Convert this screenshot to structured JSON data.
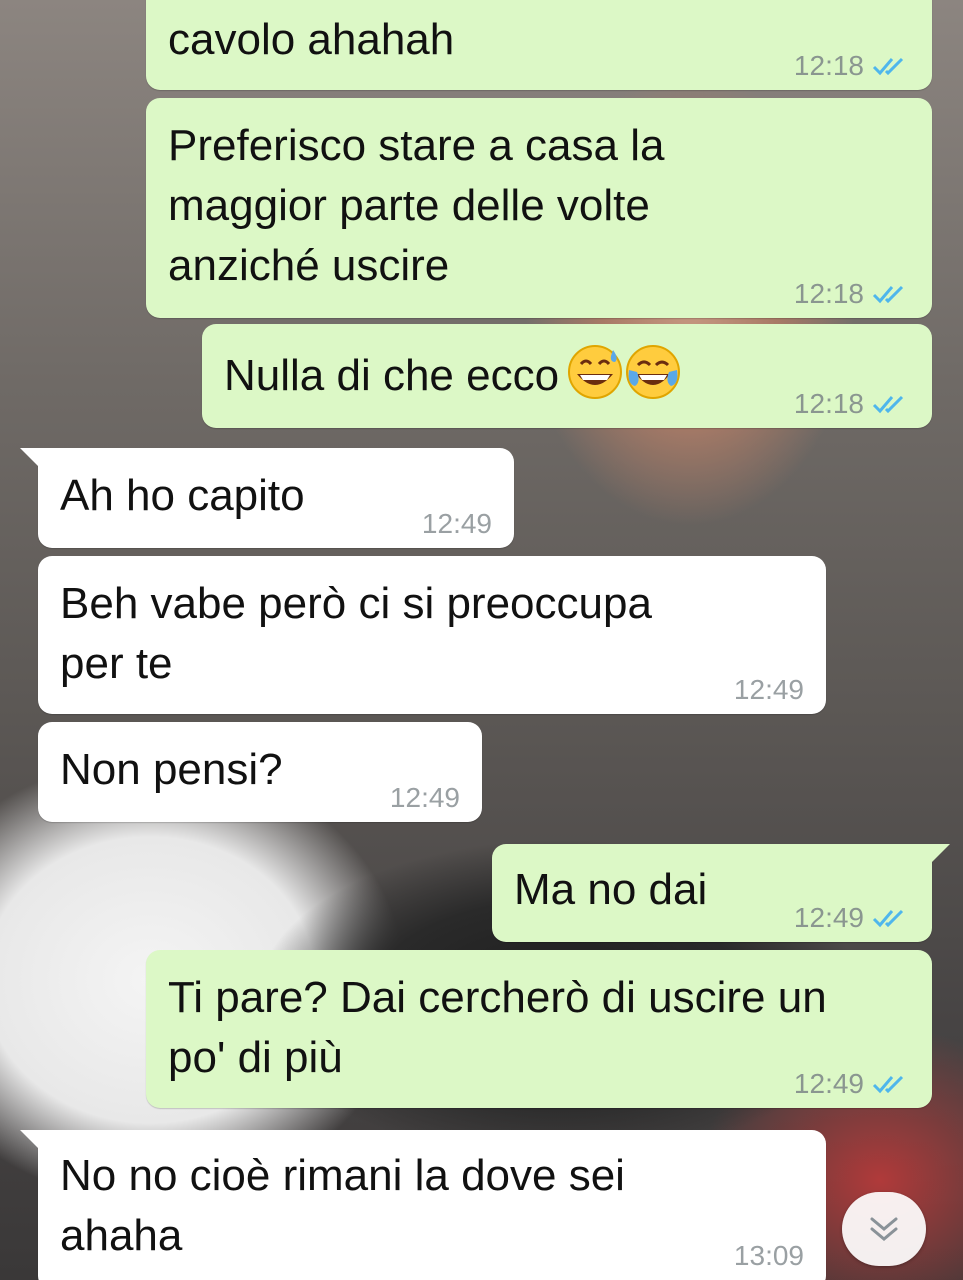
{
  "messages": [
    {
      "id": "m1",
      "direction": "outgoing",
      "text": "cavolo ahahah",
      "time": "12:18",
      "status": "read"
    },
    {
      "id": "m2",
      "direction": "outgoing",
      "text": "Preferisco stare a casa la\nmaggior parte delle volte\nanziché uscire",
      "time": "12:18",
      "status": "read"
    },
    {
      "id": "m3",
      "direction": "outgoing",
      "text": "Nulla di che ecco",
      "emojis": [
        "grinning-sweat-emoji",
        "tears-of-joy-emoji"
      ],
      "time": "12:18",
      "status": "read"
    },
    {
      "id": "m4",
      "direction": "incoming",
      "text": "Ah ho capito",
      "time": "12:49"
    },
    {
      "id": "m5",
      "direction": "incoming",
      "text": "Beh vabe però ci si preoccupa\nper te",
      "time": "12:49"
    },
    {
      "id": "m6",
      "direction": "incoming",
      "text": "Non pensi?",
      "time": "12:49"
    },
    {
      "id": "m7",
      "direction": "outgoing",
      "text": "Ma no dai",
      "time": "12:49",
      "status": "read"
    },
    {
      "id": "m8",
      "direction": "outgoing",
      "text": "Ti pare? Dai cercherò di uscire un\npo' di più",
      "time": "12:49",
      "status": "read"
    },
    {
      "id": "m9",
      "direction": "incoming",
      "text": "No no cioè rimani la dove sei\nahaha",
      "time": "13:09"
    }
  ],
  "colors": {
    "outgoing_bubble": "#dcf8c6",
    "incoming_bubble": "#ffffff",
    "read_ticks": "#4fb6ec"
  },
  "icons": {
    "read_status": "double-check-icon",
    "scroll_down": "double-chevron-down-icon"
  }
}
